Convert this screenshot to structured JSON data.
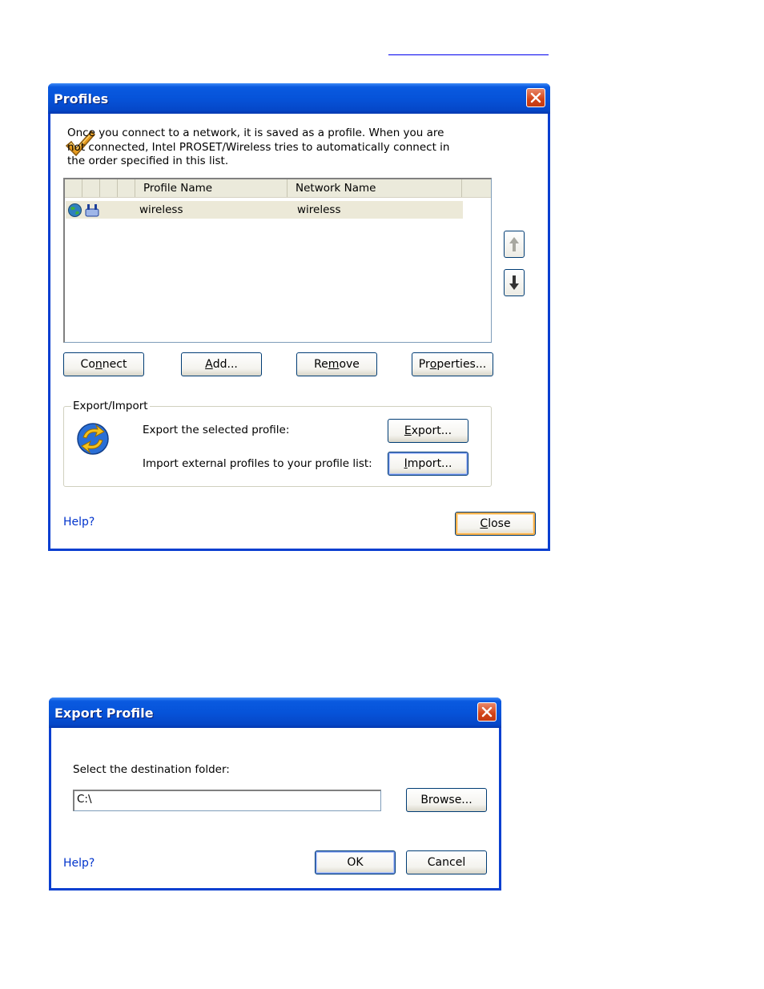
{
  "profiles_dialog": {
    "title": "Profiles",
    "intro": "Once you connect to a network, it is saved as a profile. When you are not connected, Intel PROSET/Wireless tries to automatically connect in the order specified in this list.",
    "columns": [
      "Profile Name",
      "Network Name"
    ],
    "rows": [
      {
        "profile_name": "wireless",
        "network_name": "wireless",
        "icons": [
          "globe-icon",
          "network-adapter-icon"
        ]
      }
    ],
    "buttons": {
      "connect": {
        "pre": "Co",
        "u": "n",
        "post": "nect"
      },
      "add": {
        "pre": "",
        "u": "A",
        "post": "dd..."
      },
      "remove": {
        "pre": "Re",
        "u": "m",
        "post": "ove"
      },
      "properties": {
        "pre": "Pr",
        "u": "o",
        "post": "perties..."
      },
      "export": {
        "pre": "",
        "u": "E",
        "post": "xport..."
      },
      "import": {
        "pre": "",
        "u": "I",
        "post": "mport..."
      },
      "close": {
        "pre": "",
        "u": "C",
        "post": "lose"
      }
    },
    "export_import": {
      "group_title": "Export/Import",
      "export_label": "Export the selected profile:",
      "import_label": "Import external profiles to your profile list:"
    },
    "help": "Help?",
    "icons": {
      "move_up": "arrow-up-icon",
      "move_down": "arrow-down-icon",
      "banner": "checkmark-icon",
      "export_import": "export-import-icon"
    }
  },
  "export_dialog": {
    "title": "Export Profile",
    "prompt": "Select the destination folder:",
    "folder_value": "C:\\",
    "browse": "Browse...",
    "ok": "OK",
    "cancel": "Cancel",
    "help": "Help?"
  },
  "colors": {
    "title_blue": "#0653d9",
    "close_red": "#d34316",
    "help_link": "#0033cc",
    "row_highlight": "#ece9d8"
  }
}
